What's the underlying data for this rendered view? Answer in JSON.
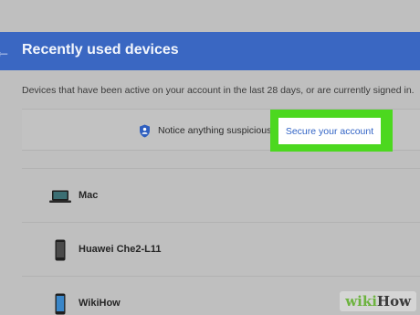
{
  "header": {
    "back_icon": "arrow-left-icon",
    "title": "Recently used devices"
  },
  "description": "Devices that have been active on your account in the last 28 days, or are currently signed in.",
  "notice": {
    "icon": "shield-icon",
    "text": "Notice anything suspicious?",
    "link_label": "Secure your account"
  },
  "devices": [
    {
      "icon": "laptop-icon",
      "name": "Mac"
    },
    {
      "icon": "phone-icon",
      "name": "Huawei Che2-L11"
    },
    {
      "icon": "phone-icon",
      "name": "WikiHow"
    }
  ],
  "colors": {
    "header_bg": "#3a67c2",
    "highlight": "#4cd81f",
    "link": "#3264c6"
  },
  "watermark": {
    "part1": "wiki",
    "part2": "How"
  }
}
